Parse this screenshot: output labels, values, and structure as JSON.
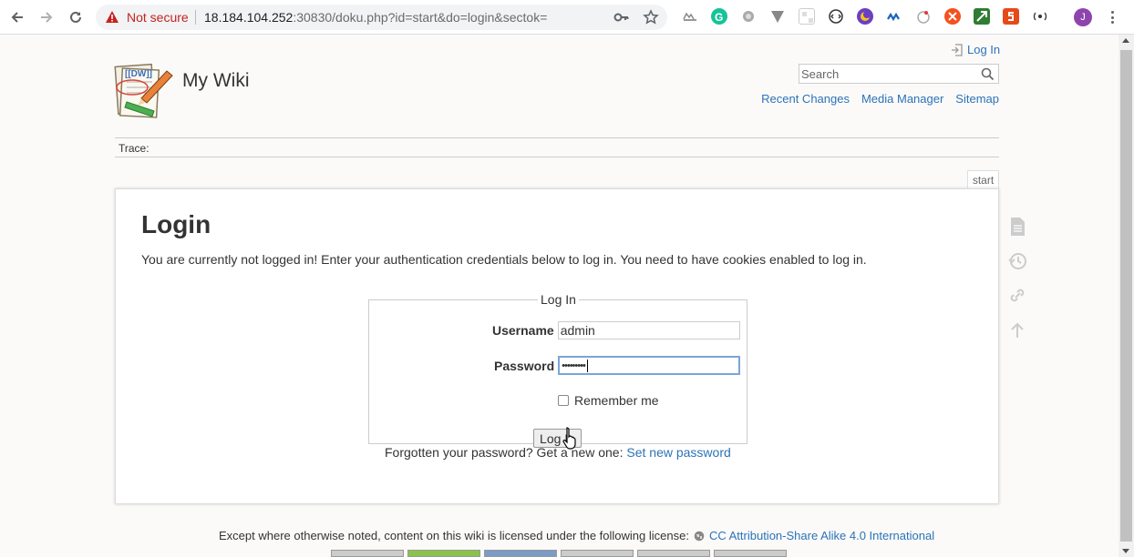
{
  "browser": {
    "security_label": "Not secure",
    "url_host": "18.184.104.252",
    "url_rest": ":30830/doku.php?id=start&do=login&sectok=",
    "profile_initial": "J"
  },
  "wiki": {
    "site_name": "My Wiki",
    "login_link": "Log In",
    "search_placeholder": "Search",
    "user_tools": [
      "Recent Changes",
      "Media Manager",
      "Sitemap"
    ],
    "trace_label": "Trace:",
    "page_id_tab": "start"
  },
  "login": {
    "title": "Login",
    "intro": "You are currently not logged in! Enter your authentication credentials below to log in. You need to have cookies enabled to log in.",
    "legend": "Log In",
    "username_label": "Username",
    "username_value": "admin",
    "password_label": "Password",
    "password_value": "•••••••••",
    "remember_label": "Remember me",
    "submit_label": "Log In",
    "forgot_text": "Forgotten your password? Get a new one:",
    "forgot_link": "Set new password"
  },
  "footer": {
    "license_text": "Except where otherwise noted, content on this wiki is licensed under the following license:",
    "license_link": "CC Attribution-Share Alike 4.0 International"
  },
  "colors": {
    "link": "#2b73b7",
    "warning": "#c5221f",
    "page_bg": "#fbfaf9"
  }
}
